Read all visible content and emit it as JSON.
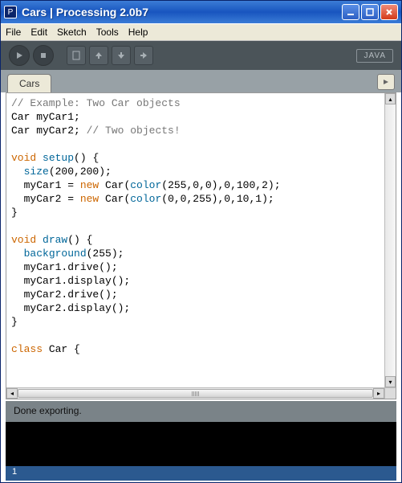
{
  "window": {
    "title": "Cars  |  Processing 2.0b7"
  },
  "menu": {
    "file": "File",
    "edit": "Edit",
    "sketch": "Sketch",
    "tools": "Tools",
    "help": "Help"
  },
  "toolbar": {
    "mode": "JAVA"
  },
  "tabs": {
    "active": "Cars"
  },
  "code": {
    "l1a": "// Example: Two Car objects",
    "l2a": "Car myCar1;",
    "l3a": "Car myCar2; ",
    "l3b": "// Two objects!",
    "l5a": "void",
    "l5b": " ",
    "l5c": "setup",
    "l5d": "() {",
    "l6a": "  ",
    "l6b": "size",
    "l6c": "(200,200);",
    "l7a": "  myCar1 = ",
    "l7b": "new",
    "l7c": " Car(",
    "l7d": "color",
    "l7e": "(255,0,0),0,100,2);",
    "l8a": "  myCar2 = ",
    "l8b": "new",
    "l8c": " Car(",
    "l8d": "color",
    "l8e": "(0,0,255),0,10,1);",
    "l9a": "}",
    "l11a": "void",
    "l11b": " ",
    "l11c": "draw",
    "l11d": "() {",
    "l12a": "  ",
    "l12b": "background",
    "l12c": "(255);",
    "l13a": "  myCar1.drive();",
    "l14a": "  myCar1.display();",
    "l15a": "  myCar2.drive();",
    "l16a": "  myCar2.display();",
    "l17a": "}",
    "l19a": "class",
    "l19b": " Car {"
  },
  "status": {
    "text": "Done exporting."
  },
  "footer": {
    "line": "1"
  }
}
